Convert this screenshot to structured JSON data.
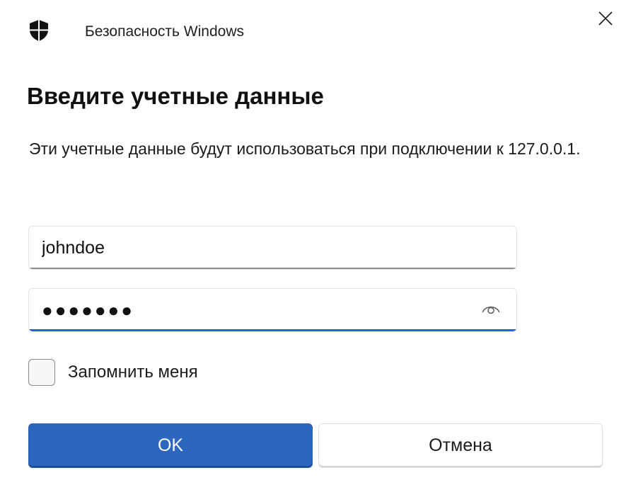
{
  "window": {
    "title": "Безопасность Windows",
    "app_icon": "shield-icon",
    "close_icon": "close-icon"
  },
  "dialog": {
    "heading": "Введите учетные данные",
    "description": "Эти учетные данные будут использоваться при подключении к 127.0.0.1."
  },
  "form": {
    "username_value": "johndoe",
    "password_display": "●●●●●●●",
    "reveal_icon": "eye-icon",
    "password_focused": true,
    "remember_label": "Запомнить меня",
    "remember_checked": false
  },
  "buttons": {
    "ok_label": "OK",
    "cancel_label": "Отмена"
  },
  "colors": {
    "accent": "#2d66be",
    "focus_underline": "#2c63c0",
    "background": "#ffffff"
  }
}
